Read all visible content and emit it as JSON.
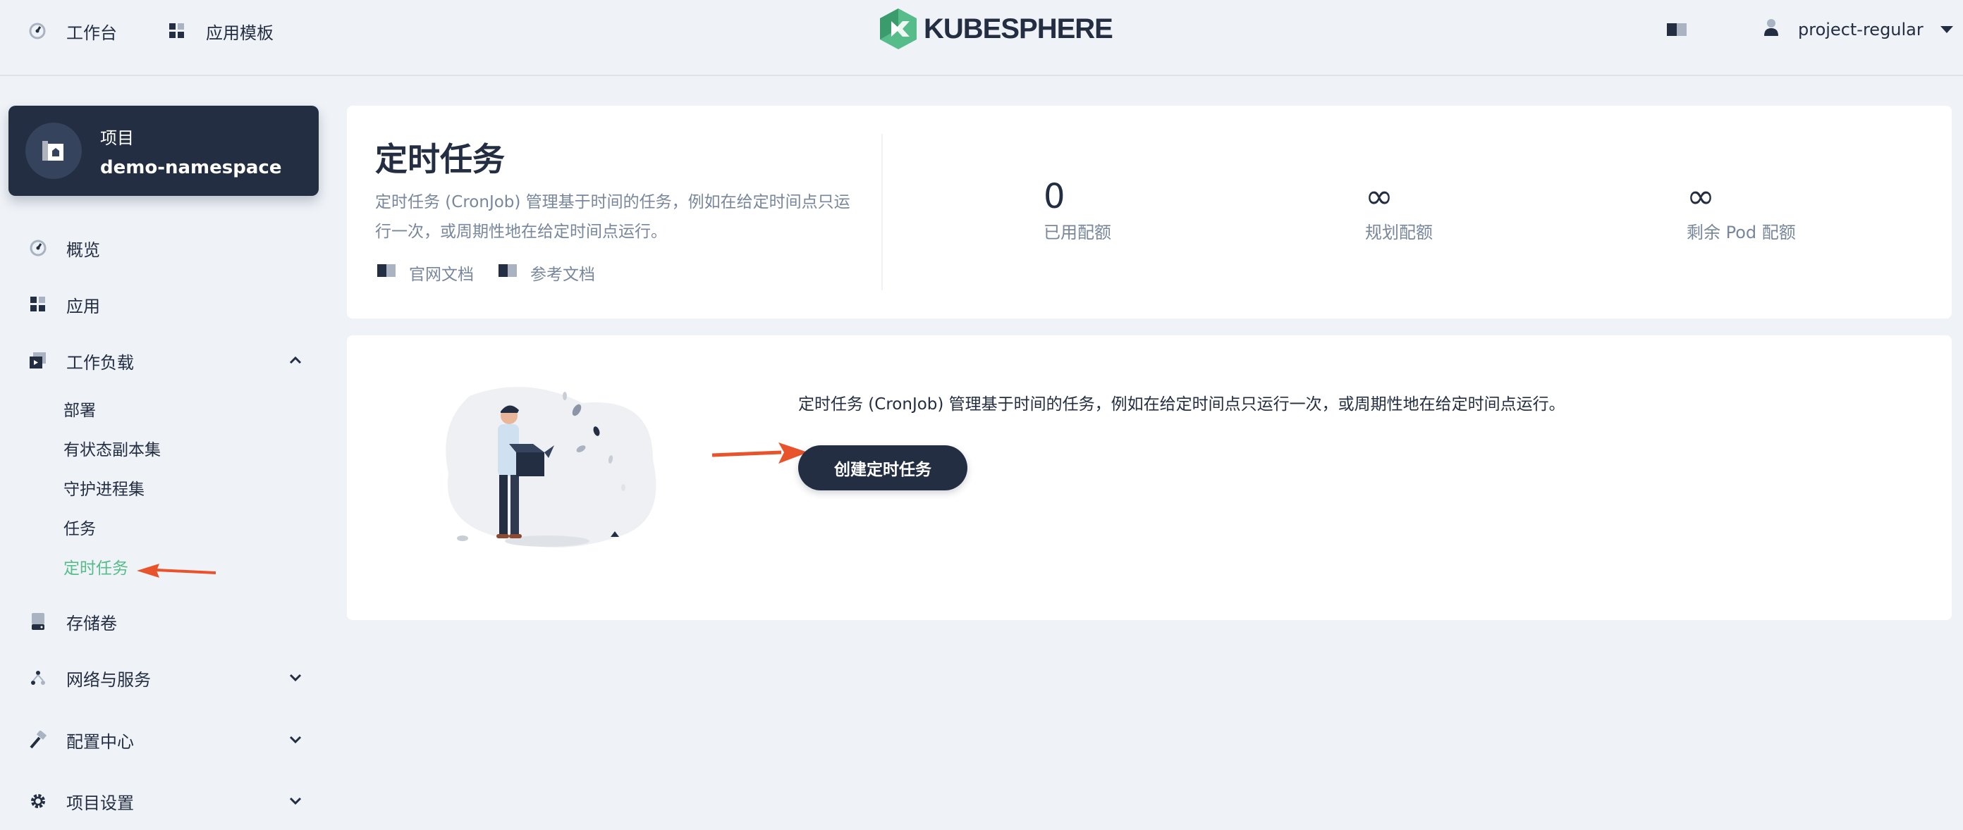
{
  "topbar": {
    "workbench": "工作台",
    "app_templates": "应用模板",
    "logo_text": "KUBESPHERE",
    "username": "project-regular"
  },
  "project": {
    "type_label": "项目",
    "name": "demo-namespace"
  },
  "sidebar": {
    "overview": "概览",
    "apps": "应用",
    "workloads": "工作负载",
    "workload_items": [
      "部署",
      "有状态副本集",
      "守护进程集",
      "任务",
      "定时任务"
    ],
    "storage": "存储卷",
    "network": "网络与服务",
    "config": "配置中心",
    "settings": "项目设置"
  },
  "header": {
    "title": "定时任务",
    "description": "定时任务 (CronJob) 管理基于时间的任务，例如在给定时间点只运行一次，或周期性地在给定时间点运行。",
    "doc_official": "官网文档",
    "doc_reference": "参考文档"
  },
  "quota": [
    {
      "value": "0",
      "label": "已用配额"
    },
    {
      "value": "∞",
      "label": "规划配额"
    },
    {
      "value": "∞",
      "label": "剩余 Pod 配额"
    }
  ],
  "empty_state": {
    "description": "定时任务 (CronJob) 管理基于时间的任务，例如在给定时间点只运行一次，或周期性地在给定时间点运行。",
    "create_button": "创建定时任务"
  },
  "colors": {
    "accent_green": "#55bc8a",
    "dark": "#242e42",
    "annotation_arrow": "#e8532b"
  }
}
